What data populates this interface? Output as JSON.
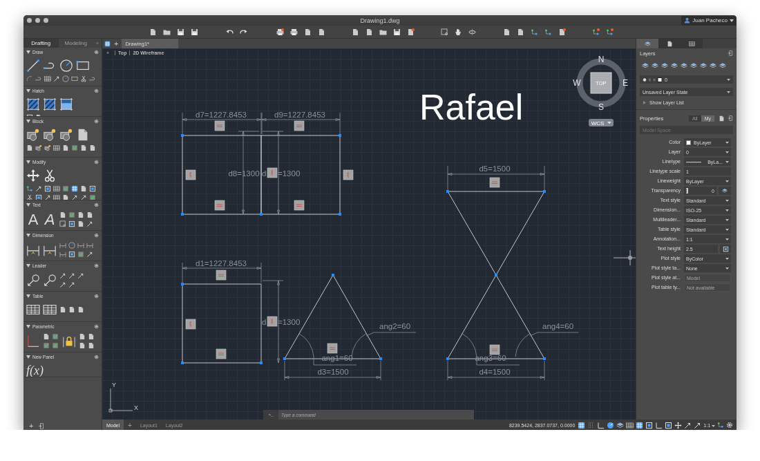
{
  "window": {
    "title": "Drawing1.dwg"
  },
  "user": {
    "name": "Juan Pacheco"
  },
  "palette": {
    "tabs": [
      {
        "label": "Drafting",
        "selected": true
      },
      {
        "label": "Modeling",
        "selected": false
      }
    ],
    "collapse": "«",
    "sections": [
      {
        "title": "Draw",
        "expanded": true
      },
      {
        "title": "Hatch",
        "expanded": true
      },
      {
        "title": "Block",
        "expanded": true
      },
      {
        "title": "Modify",
        "expanded": true
      },
      {
        "title": "Text",
        "expanded": true,
        "glyphs": [
          "A",
          "A"
        ]
      },
      {
        "title": "Dimension",
        "expanded": true
      },
      {
        "title": "Leader",
        "expanded": true
      },
      {
        "title": "Table",
        "expanded": true
      },
      {
        "title": "Parametric",
        "expanded": true
      },
      {
        "title": "New Panel",
        "expanded": true,
        "formula": "f(x)"
      }
    ]
  },
  "palette_add": "+",
  "doc_new_tab": "+",
  "doc_tabs": [
    {
      "label": "Drawing1*",
      "selected": true
    }
  ],
  "viewport": {
    "menu": "+",
    "view": "Top",
    "style": "2D Wireframe"
  },
  "compass": {
    "north": "N",
    "south": "S",
    "east": "E",
    "west": "W",
    "view": "TOP",
    "ucs": "WCS"
  },
  "annotation": "Rafael",
  "dimension_labels": [
    "d7=1227.8453",
    "d9=1227.8453",
    "d8=1300",
    "d",
    "=1300",
    "d1=1227.8453",
    "d",
    "=1300",
    "ang2=60",
    "ang1=60",
    "d3=1500",
    "d5=1500",
    "ang4=60",
    "ang3=60",
    "d4=1500"
  ],
  "axis": {
    "y": "Y",
    "x": "X"
  },
  "command_line": {
    "prompt": ">_",
    "placeholder": "Type a command"
  },
  "layout_add": "+",
  "layout_tabs": [
    {
      "label": "Model",
      "selected": true
    },
    {
      "label": "Layout1",
      "selected": false
    },
    {
      "label": "Layout2",
      "selected": false
    }
  ],
  "status_bar": {
    "coordinates": "8239.5424, 2837.0737, 0.0000",
    "scale": "1:1"
  },
  "panel": {
    "tabs": [
      {
        "selected": true
      },
      {
        "selected": false
      },
      {
        "selected": false
      }
    ],
    "layers": {
      "title": "Layers",
      "current_layer": "0",
      "layer_state": "Unsaved Layer State",
      "show_list": "Show Layer List"
    },
    "properties": {
      "title": "Properties",
      "filters": [
        {
          "label": "All",
          "selected": false
        },
        {
          "label": "My",
          "selected": true
        }
      ],
      "space": "Model Space",
      "rows": [
        {
          "label": "Color",
          "value": "ByLayer",
          "kind": "color"
        },
        {
          "label": "Layer",
          "value": "0",
          "kind": "dropdown"
        },
        {
          "label": "Linetype",
          "value": "ByLa...",
          "kind": "linetype"
        },
        {
          "label": "Linetype scale",
          "value": "1",
          "kind": "input"
        },
        {
          "label": "Lineweight",
          "value": "ByLayer",
          "kind": "dropdown"
        },
        {
          "label": "Transparency",
          "value": "0",
          "kind": "slider",
          "level": 0
        },
        {
          "label": "Text style",
          "value": "Standard",
          "kind": "dropdown"
        },
        {
          "label": "Dimension...",
          "value": "ISO-25",
          "kind": "dropdown"
        },
        {
          "label": "Multileader...",
          "value": "Standard",
          "kind": "dropdown"
        },
        {
          "label": "Table style",
          "value": "Standard",
          "kind": "dropdown"
        },
        {
          "label": "Annotation...",
          "value": "1:1",
          "kind": "dropdown"
        },
        {
          "label": "Text height",
          "value": "2.5",
          "kind": "picker"
        },
        {
          "label": "Plot style",
          "value": "ByColor",
          "kind": "dropdown"
        },
        {
          "label": "Plot style ta...",
          "value": "None",
          "kind": "dropdown"
        },
        {
          "label": "Plot style at...",
          "value": "Model",
          "kind": "readonly"
        },
        {
          "label": "Plot table ty...",
          "value": "Not available",
          "kind": "readonly"
        }
      ]
    }
  }
}
